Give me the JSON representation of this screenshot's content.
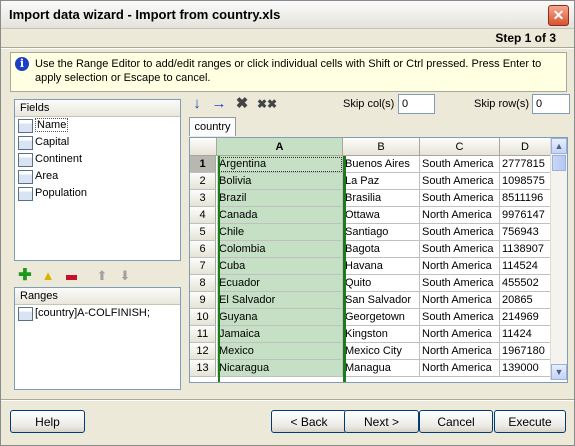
{
  "window": {
    "title": "Import data wizard - Import from country.xls",
    "step": "Step 1 of 3"
  },
  "info": {
    "message": "Use the Range Editor to add/edit ranges or click individual cells with Shift or Ctrl pressed. Press Enter to apply selection or Escape to cancel."
  },
  "fields": {
    "header": "Fields",
    "items": [
      "Name",
      "Capital",
      "Continent",
      "Area",
      "Population"
    ]
  },
  "ranges": {
    "header": "Ranges",
    "items": [
      "[country]A-COLFINISH;"
    ]
  },
  "skip": {
    "cols_label": "Skip col(s)",
    "cols_value": "0",
    "rows_label": "Skip row(s)",
    "rows_value": "0"
  },
  "sheet_tab": "country",
  "grid": {
    "columns": [
      "A",
      "B",
      "C",
      "D"
    ],
    "rows": [
      {
        "n": "1",
        "a": "Argentina",
        "b": "Buenos Aires",
        "c": "South America",
        "d": "2777815"
      },
      {
        "n": "2",
        "a": "Bolivia",
        "b": "La Paz",
        "c": "South America",
        "d": "1098575"
      },
      {
        "n": "3",
        "a": "Brazil",
        "b": "Brasilia",
        "c": "South America",
        "d": "8511196"
      },
      {
        "n": "4",
        "a": "Canada",
        "b": "Ottawa",
        "c": "North America",
        "d": "9976147"
      },
      {
        "n": "5",
        "a": "Chile",
        "b": "Santiago",
        "c": "South America",
        "d": "756943"
      },
      {
        "n": "6",
        "a": "Colombia",
        "b": "Bagota",
        "c": "South America",
        "d": "1138907"
      },
      {
        "n": "7",
        "a": "Cuba",
        "b": "Havana",
        "c": "North America",
        "d": "114524"
      },
      {
        "n": "8",
        "a": "Ecuador",
        "b": "Quito",
        "c": "South America",
        "d": "455502"
      },
      {
        "n": "9",
        "a": "El Salvador",
        "b": "San Salvador",
        "c": "North America",
        "d": "20865"
      },
      {
        "n": "10",
        "a": "Guyana",
        "b": "Georgetown",
        "c": "South America",
        "d": "214969"
      },
      {
        "n": "11",
        "a": "Jamaica",
        "b": "Kingston",
        "c": "North America",
        "d": "11424"
      },
      {
        "n": "12",
        "a": "Mexico",
        "b": "Mexico City",
        "c": "North America",
        "d": "1967180"
      },
      {
        "n": "13",
        "a": "Nicaragua",
        "b": "Managua",
        "c": "North America",
        "d": "139000"
      }
    ]
  },
  "buttons": {
    "help": "Help",
    "back": "< Back",
    "next": "Next >",
    "cancel": "Cancel",
    "execute": "Execute"
  },
  "colors": {
    "selected_column": "#c6e0c5",
    "info_bg": "#ffffe1",
    "close_button": "#d8532f"
  }
}
